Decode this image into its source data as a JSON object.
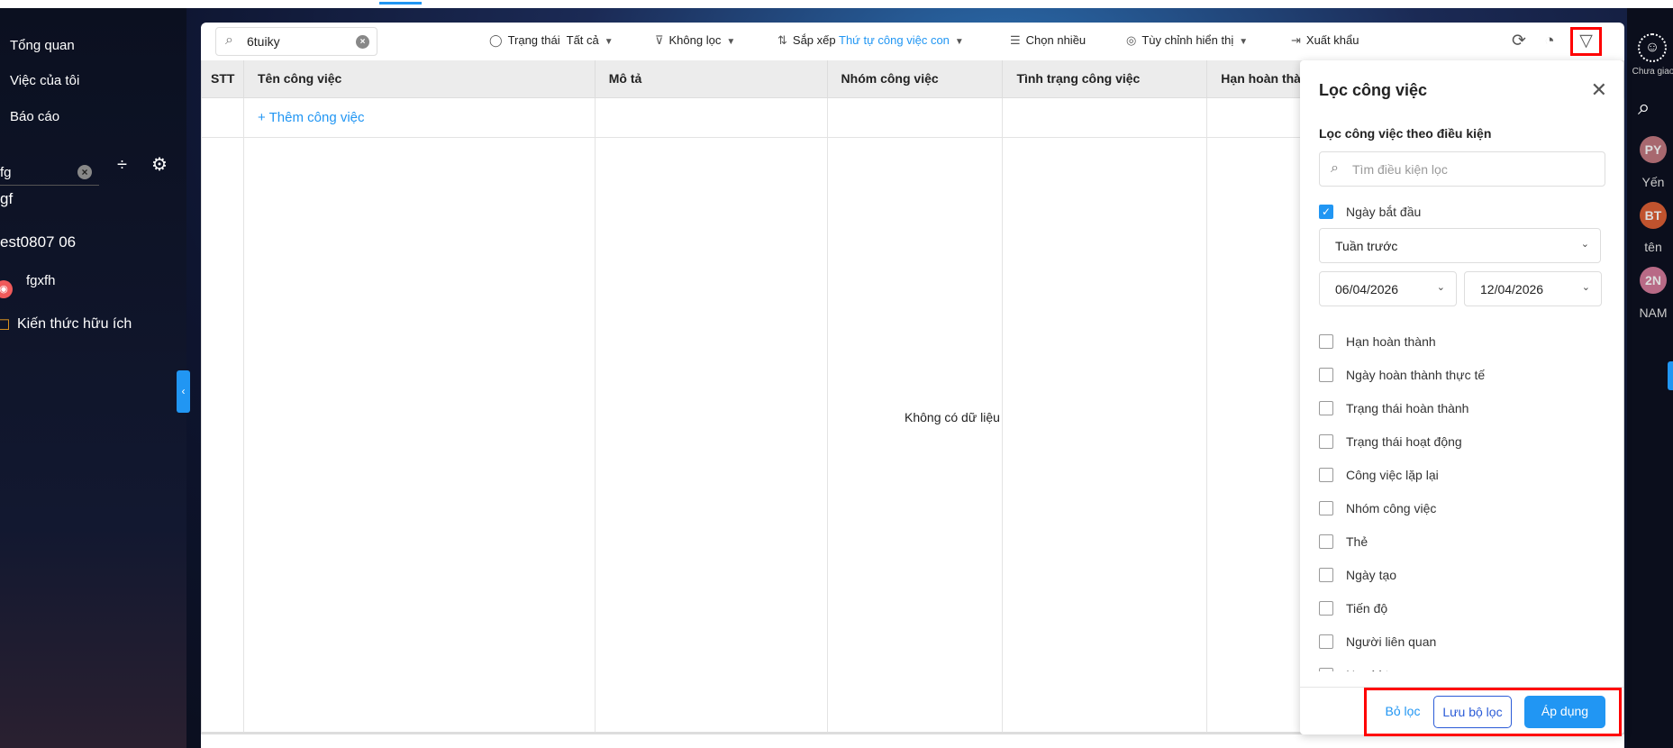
{
  "sidebar": {
    "nav": [
      "Tổng quan",
      "Việc của tôi",
      "Báo cáo"
    ],
    "search_value": "fg",
    "projects": [
      "gf",
      "est0807 06",
      "fgxfh"
    ],
    "knowledge": "Kiến thức hữu ích"
  },
  "toolbar": {
    "search_value": "6tuiky",
    "status_label": "Trạng thái",
    "status_value": "Tất cả",
    "filter_label": "Không lọc",
    "sort_label": "Sắp xếp",
    "sort_value": "Thứ tự công việc con",
    "multi_select": "Chọn nhiều",
    "customize": "Tùy chỉnh hiển thị",
    "export": "Xuất khẩu"
  },
  "table": {
    "columns": [
      "STT",
      "Tên công việc",
      "Mô tả",
      "Nhóm công việc",
      "Tình trạng công việc",
      "Hạn hoàn thành"
    ],
    "add_task": "+ Thêm công việc",
    "empty": "Không có dữ liệu"
  },
  "rail": {
    "unassigned": "Chưa giao",
    "users": [
      {
        "initials": "PY",
        "name": "Yến",
        "color": "#a8686f"
      },
      {
        "initials": "BT",
        "name": "tên",
        "color": "#c0532e"
      },
      {
        "initials": "2N",
        "name": "NAM",
        "color": "#b86a86"
      }
    ]
  },
  "filter_panel": {
    "title": "Lọc công việc",
    "subtitle": "Lọc công việc theo điều kiện",
    "search_placeholder": "Tìm điều kiện lọc",
    "start_date": {
      "label": "Ngày bắt đầu",
      "checked": true,
      "range": "Tuần trước",
      "from": "06/04/2026",
      "to": "12/04/2026"
    },
    "conditions": [
      "Hạn hoàn thành",
      "Ngày hoàn thành thực tế",
      "Trạng thái hoàn thành",
      "Trạng thái hoạt động",
      "Công việc lặp lại",
      "Nhóm công việc",
      "Thẻ",
      "Ngày tạo",
      "Tiến độ",
      "Người liên quan",
      "Người tạo"
    ],
    "clear": "Bỏ lọc",
    "save": "Lưu bộ lọc",
    "apply": "Áp dụng"
  }
}
